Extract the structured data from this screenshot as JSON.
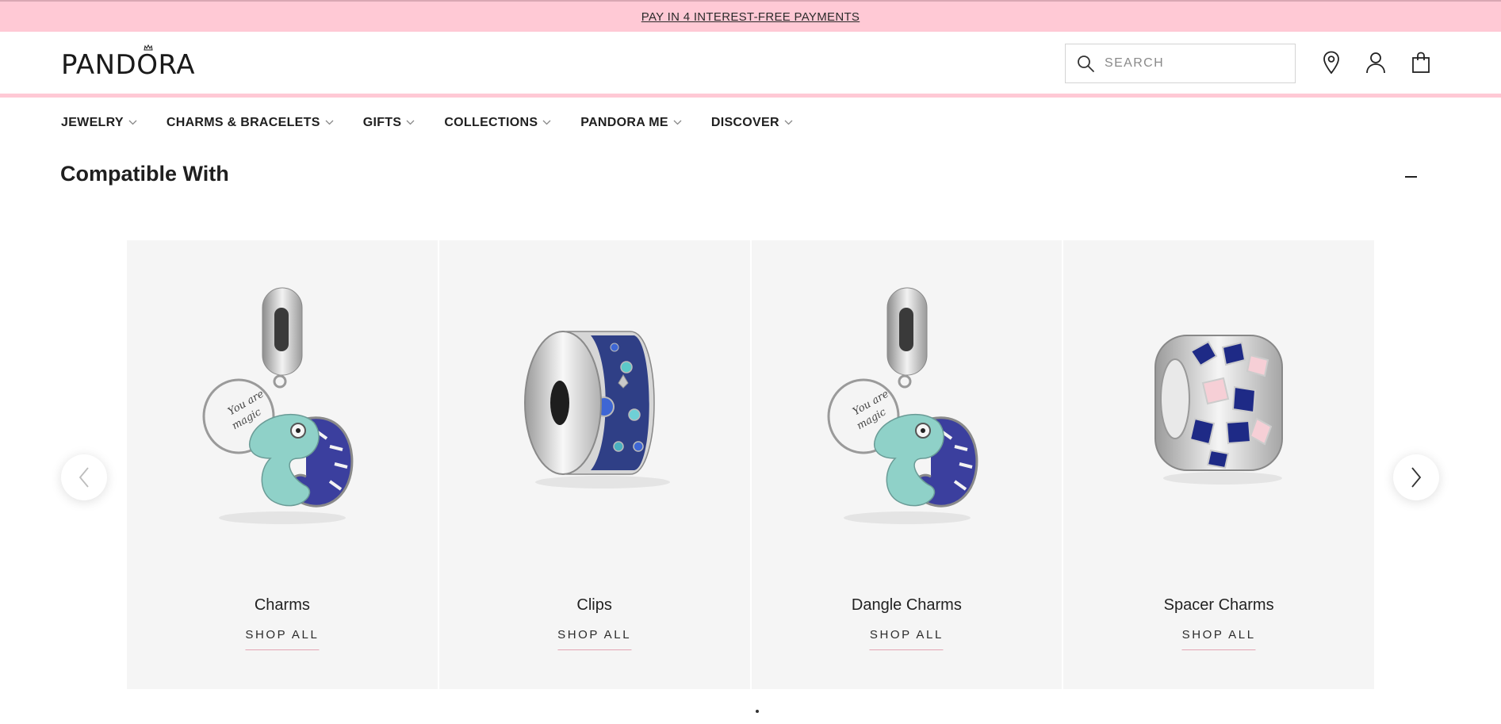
{
  "promo": {
    "text": "PAY IN 4 INTEREST-FREE PAYMENTS"
  },
  "header": {
    "logo": "PANDORA",
    "search_placeholder": "SEARCH",
    "icons": [
      "location-icon",
      "account-icon",
      "shopping-bag-icon"
    ]
  },
  "nav": {
    "items": [
      {
        "label": "JEWELRY"
      },
      {
        "label": "CHARMS & BRACELETS"
      },
      {
        "label": "GIFTS"
      },
      {
        "label": "COLLECTIONS"
      },
      {
        "label": "PANDORA ME"
      },
      {
        "label": "DISCOVER"
      }
    ]
  },
  "section": {
    "title": "Compatible With"
  },
  "cards": [
    {
      "name": "Charms",
      "cta": "SHOP ALL"
    },
    {
      "name": "Clips",
      "cta": "SHOP ALL"
    },
    {
      "name": "Dangle Charms",
      "cta": "SHOP ALL"
    },
    {
      "name": "Spacer Charms",
      "cta": "SHOP ALL"
    }
  ],
  "colors": {
    "promo_pink": "#ffc9d5",
    "card_bg": "#f5f5f5",
    "cta_underline": "#e3a4b3"
  }
}
